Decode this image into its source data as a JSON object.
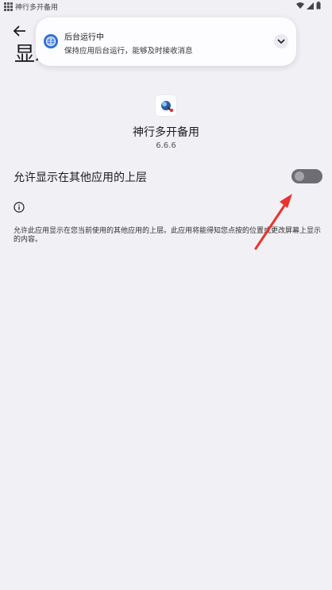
{
  "status_bar": {
    "app_name": "神行多开备用",
    "icons": [
      "grid-icon",
      "wifi-icon",
      "signal-icon",
      "battery-icon"
    ]
  },
  "header": {
    "back_icon": "arrow-left-icon",
    "title": "显示"
  },
  "notification": {
    "icon": "globe-icon",
    "title": "后台运行中",
    "body": "保持应用后台运行，能够及时接收消息",
    "expand_icon": "chevron-down-icon"
  },
  "app": {
    "name": "神行多开备用",
    "version": "6.6.6"
  },
  "overlay_permission": {
    "label": "允许显示在其他应用的上层",
    "enabled": false
  },
  "info": {
    "icon": "info-icon",
    "text": "允许此应用显示在您当前使用的其他应用的上层。此应用将能得知您点按的位置或更改屏幕上显示的内容。"
  },
  "annotation": {
    "color": "#e8332e"
  }
}
